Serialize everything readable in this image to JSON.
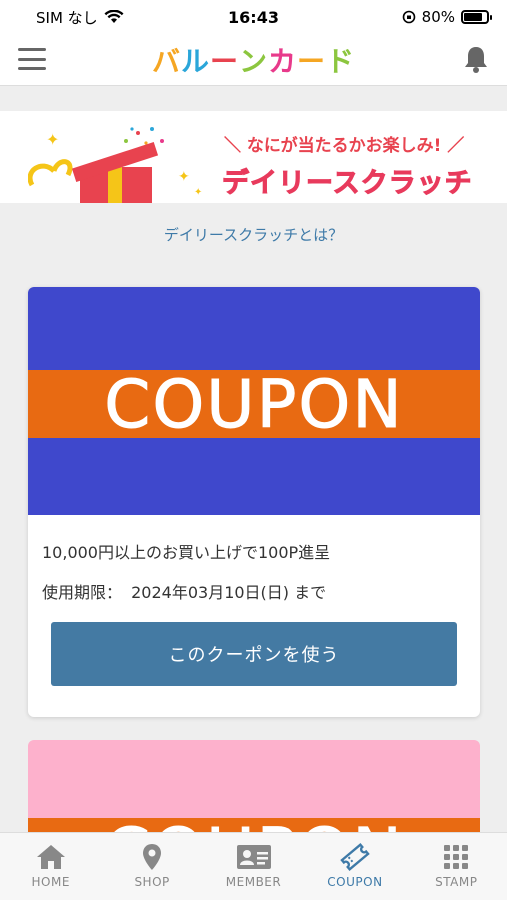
{
  "status_bar": {
    "carrier": "SIM なし",
    "time": "16:43",
    "battery": "80%",
    "battery_level": 0.8
  },
  "header": {
    "logo_text": [
      "バ",
      "ル",
      "ー",
      "ン",
      "カ",
      "ー",
      "ド"
    ],
    "logo_colors": [
      "#f5a623",
      "#2ba6d9",
      "#e8434f",
      "#8cc63f",
      "#e83a8b",
      "#f5a623",
      "#8cc63f"
    ],
    "menu_icon": "hamburger-menu-icon",
    "bell_icon": "bell-icon"
  },
  "banner": {
    "tagline": "＼ なにが当たるかお楽しみ! ／",
    "title": "デイリースクラッチ"
  },
  "about_link": "デイリースクラッチとは？",
  "coupon": {
    "image_text": "COUPON",
    "image_bg": "#3f48cc",
    "stripe_color": "#e86a12",
    "description": "10,000円以上のお買い上げで100P進呈",
    "expiry_label": "使用期限：",
    "expiry_date": "2024年03月10日(日) まで",
    "button_label": "このクーポンを使う"
  },
  "coupon_2": {
    "image_text": "COUPON",
    "image_bg": "#fdb1cc"
  },
  "tabs": [
    {
      "label": "HOME",
      "icon": "home-icon",
      "active": false
    },
    {
      "label": "SHOP",
      "icon": "map-pin-icon",
      "active": false
    },
    {
      "label": "MEMBER",
      "icon": "member-card-icon",
      "active": false
    },
    {
      "label": "COUPON",
      "icon": "ticket-icon",
      "active": true
    },
    {
      "label": "STAMP",
      "icon": "grid-icon",
      "active": false
    }
  ]
}
